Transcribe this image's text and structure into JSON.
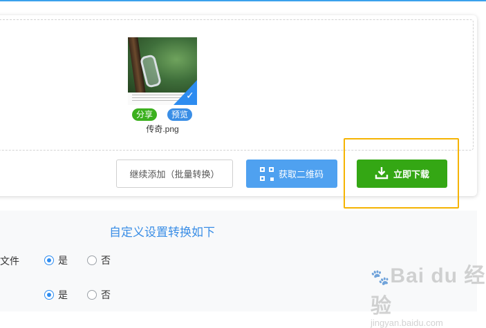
{
  "file": {
    "name": "传奇.png",
    "share_label": "分享",
    "preview_label": "预览",
    "selected": true
  },
  "actions": {
    "continue_label": "继续添加（批量转换）",
    "qr_label": "获取二维码",
    "download_label": "立即下载"
  },
  "settings": {
    "title": "自定义设置转换如下",
    "rows": [
      {
        "label_fragment": "文件",
        "options": [
          "是",
          "否"
        ],
        "selected": "是"
      },
      {
        "label_fragment": "",
        "options": [
          "是",
          "否"
        ],
        "selected": "是"
      }
    ]
  },
  "watermark": {
    "main": "Bai du 经验",
    "sub": "jingyan.baidu.com"
  },
  "colors": {
    "accent_blue": "#2d8cf0",
    "download_green": "#34a714",
    "highlight_yellow": "#f5b300"
  }
}
